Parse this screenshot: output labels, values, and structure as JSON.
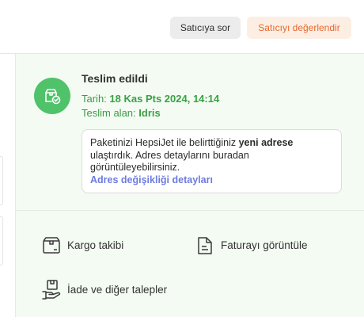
{
  "header": {
    "ask_seller_label": "Satıcıya sor",
    "rate_seller_label": "Satıcıyı değerlendir"
  },
  "delivery": {
    "status_title": "Teslim edildi",
    "date_label": "Tarih:",
    "date_value": "18 Kas Pts 2024, 14:14",
    "receiver_label": "Teslim alan:",
    "receiver_value": "Idris",
    "status_icon": "package-delivered-icon"
  },
  "notice": {
    "text_before": "Paketinizi HepsiJet ile belirttiğiniz",
    "text_bold": "yeni adrese",
    "text_after": "ulaştırdık. Adres detaylarını buradan görüntüleyebilirsiniz.",
    "link_label": "Adres değişikliği detayları"
  },
  "actions": {
    "cargo_tracking": "Kargo takibi",
    "view_invoice": "Faturayı görüntüle",
    "return_requests": "İade ve diğer talepler"
  },
  "colors": {
    "panel_bg": "#f3fbf2",
    "success_green": "#4fc26a",
    "accent_orange": "#e8672b",
    "link_blue": "#6c7be0"
  }
}
